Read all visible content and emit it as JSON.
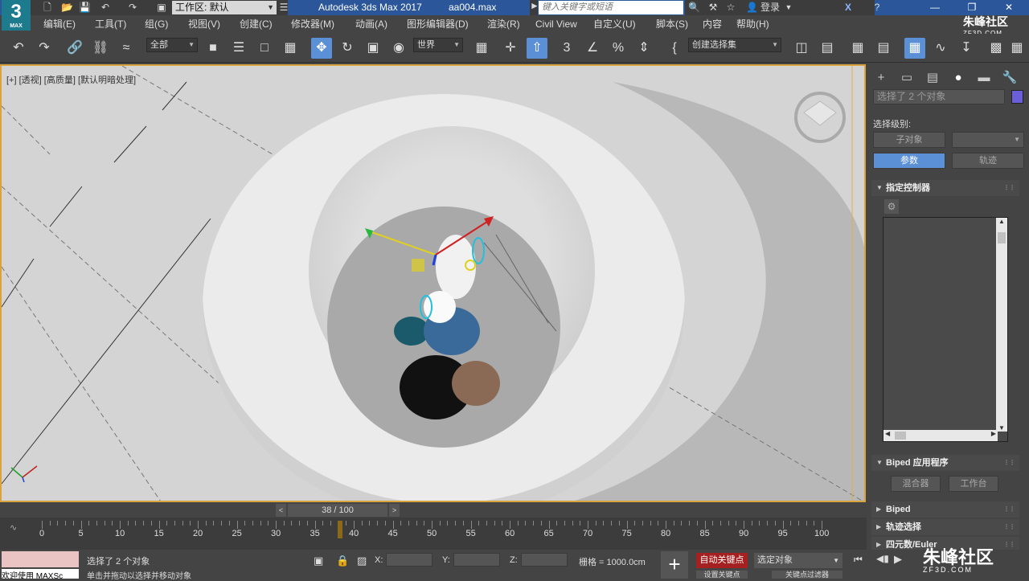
{
  "titlebar": {
    "workspace_label": "工作区: 默认",
    "app_title": "Autodesk 3ds Max 2017",
    "file_name": "aa004.max",
    "search_placeholder": "键入关键字或短语",
    "login_label": "登录",
    "logo_text": "3",
    "logo_sub": "MAX"
  },
  "menubar": {
    "items": [
      "编辑(E)",
      "工具(T)",
      "组(G)",
      "视图(V)",
      "创建(C)",
      "修改器(M)",
      "动画(A)",
      "图形编辑器(D)",
      "渲染(R)",
      "Civil View",
      "自定义(U)",
      "脚本(S)",
      "内容",
      "帮助(H)"
    ]
  },
  "toolbar": {
    "filter_dropdown": "全部",
    "coord_dropdown": "世界",
    "selection_set": "创建选择集"
  },
  "viewport": {
    "label_plus": "[+]",
    "label_view": "[透视]",
    "label_quality": "[高质量]",
    "label_lighting": "[默认明暗处理]"
  },
  "command_panel": {
    "selection_info": "选择了 2 个对象",
    "selection_level_label": "选择级别:",
    "sub_object_button": "子对象",
    "params_button": "参数",
    "track_button": "轨迹",
    "assign_controller_rollout": "指定控制器",
    "biped_apps_rollout": "Biped 应用程序",
    "mixer_button": "混合器",
    "workbench_button": "工作台",
    "biped_rollout": "Biped",
    "track_selection_rollout": "轨迹选择",
    "quaternion_rollout": "四元数/Euler",
    "swatch_color": "#6a5fd8"
  },
  "time_slider": {
    "frame_display": "38 / 100",
    "ticks": [
      "0",
      "5",
      "10",
      "15",
      "20",
      "25",
      "30",
      "35",
      "40",
      "45",
      "50",
      "55",
      "60",
      "65",
      "70",
      "75",
      "80",
      "85",
      "90",
      "95",
      "100"
    ]
  },
  "status_bar": {
    "welcome_text": "欢迎使用 MAXSc",
    "selected_text": "选择了 2 个对象",
    "x_label": "X:",
    "y_label": "Y:",
    "z_label": "Z:",
    "grid_text": "栅格 = 1000.0cm",
    "auto_key_button": "自动关键点",
    "selected_object_dropdown": "选定对象",
    "set_key_button": "设置关键点",
    "key_filter_button": "关键点过滤器",
    "hint_text": "单击并拖动以选择并移动对象"
  },
  "watermark": {
    "brand": "朱峰社区",
    "url": "ZF3D.COM"
  }
}
